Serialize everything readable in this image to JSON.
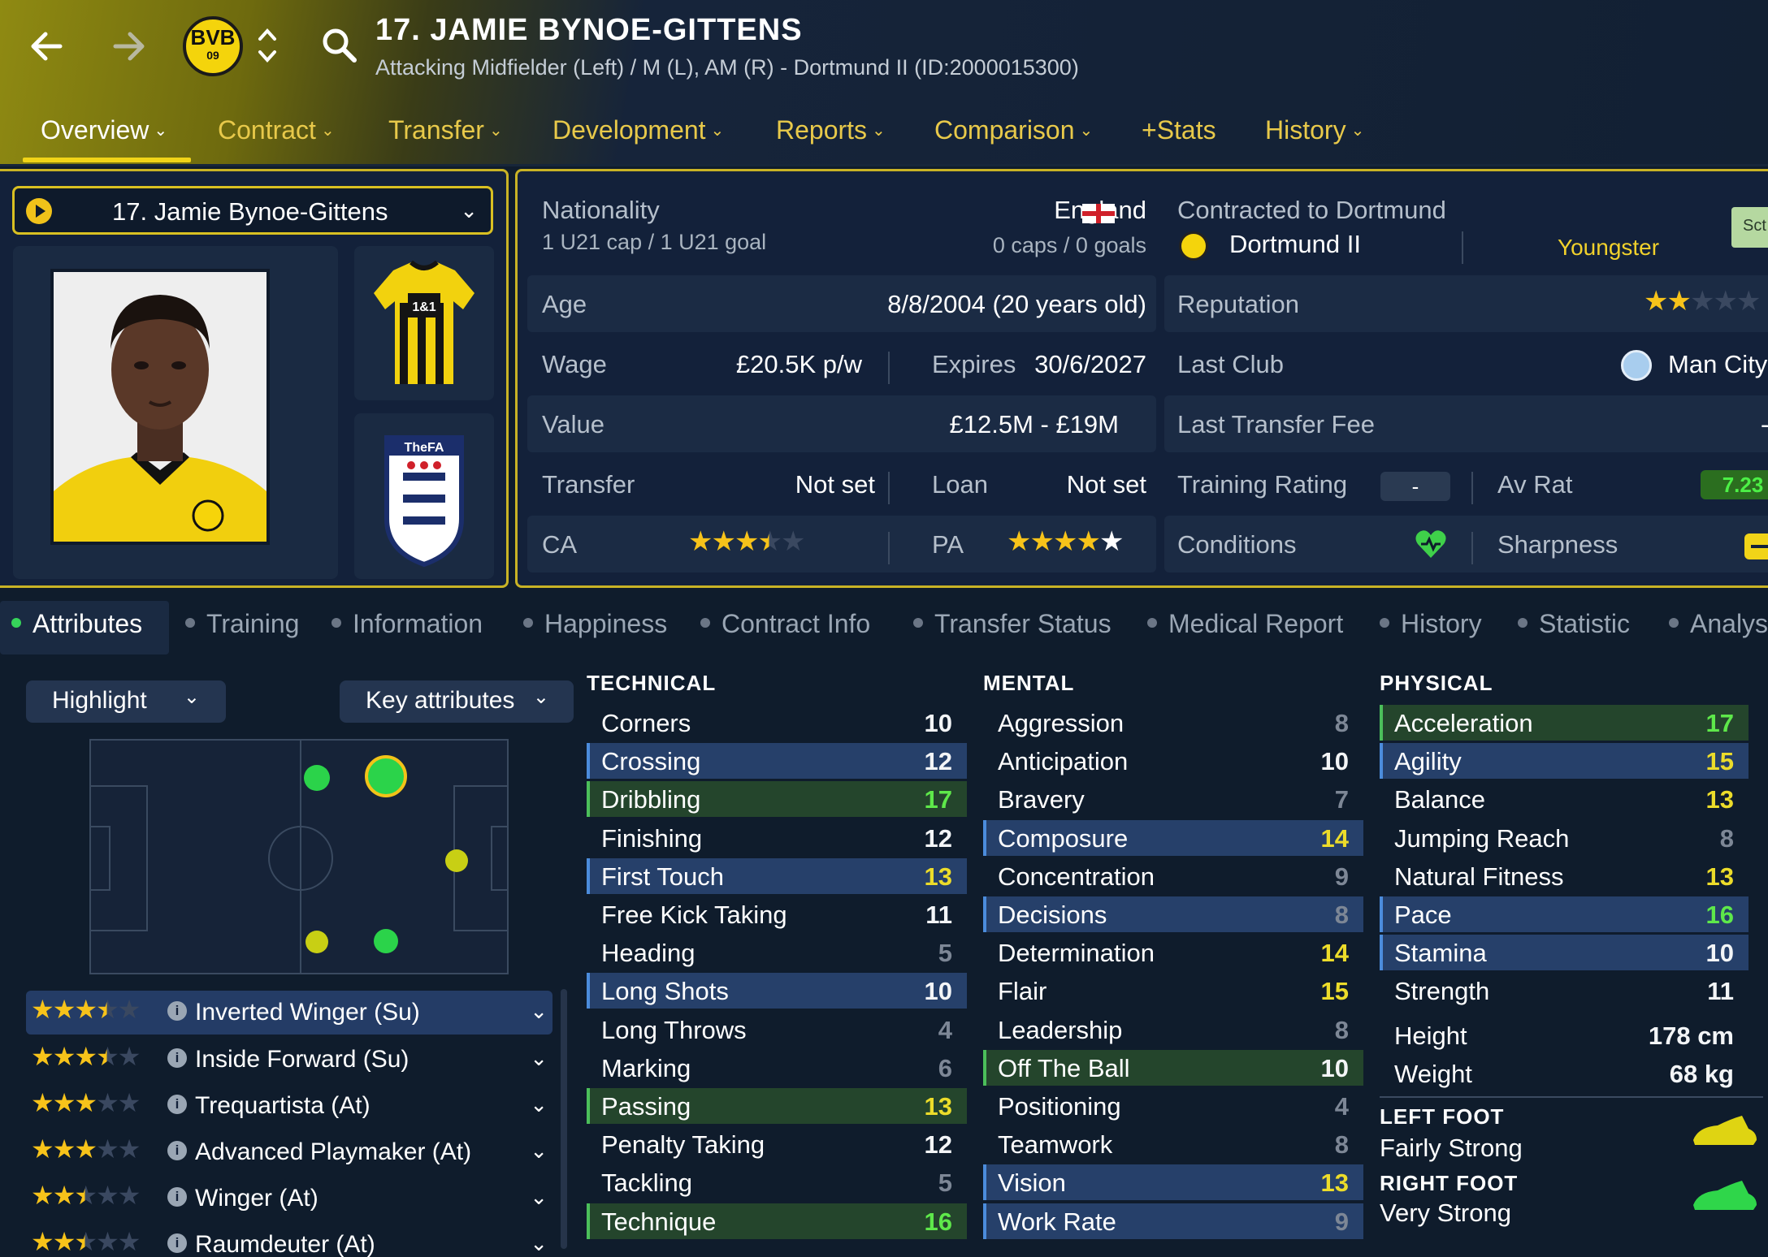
{
  "header": {
    "title": "17. JAMIE BYNOE-GITTENS",
    "subtitle": "Attacking Midfielder (Left) / M (L), AM (R) - Dortmund II (ID:2000015300)",
    "club_badge_text": "BVB",
    "club_badge_sub": "09"
  },
  "tabs": [
    {
      "label": "Overview",
      "chev": "⌄"
    },
    {
      "label": "Contract",
      "chev": "⌄"
    },
    {
      "label": "Transfer",
      "chev": "⌄"
    },
    {
      "label": "Development",
      "chev": "⌄"
    },
    {
      "label": "Reports",
      "chev": "⌄"
    },
    {
      "label": "Comparison",
      "chev": "⌄"
    },
    {
      "label": "+Stats",
      "chev": ""
    },
    {
      "label": "History",
      "chev": "⌄"
    }
  ],
  "player_select": {
    "name": "17. Jamie Bynoe-Gittens",
    "chev": "⌄"
  },
  "kit_sponsor": "1&1",
  "fa_badge": "TheFA",
  "info": {
    "nationality_label": "Nationality",
    "nationality": "England",
    "u21_caps": "1 U21 cap / 1 U21 goal",
    "caps": "0 caps / 0 goals",
    "contracted_label": "Contracted to Dortmund",
    "team": "Dortmund II",
    "youngster": "Youngster",
    "chip": "Sct",
    "age_label": "Age",
    "age": "8/8/2004 (20 years old)",
    "reputation_label": "Reputation",
    "reputation_stars": 2,
    "wage_label": "Wage",
    "wage": "£20.5K p/w",
    "expires_label": "Expires",
    "expires": "30/6/2027",
    "last_club_label": "Last Club",
    "last_club": "Man City",
    "value_label": "Value",
    "value": "£12.5M - £19M",
    "last_fee_label": "Last Transfer Fee",
    "last_fee": "-",
    "transfer_label": "Transfer",
    "transfer": "Not set",
    "loan_label": "Loan",
    "loan": "Not set",
    "training_label": "Training Rating",
    "training": "-",
    "avrat_label": "Av Rat",
    "avrat": "7.23",
    "ca_label": "CA",
    "ca_stars": 3.5,
    "pa_label": "PA",
    "pa_stars": 5,
    "conditions_label": "Conditions",
    "sharpness_label": "Sharpness"
  },
  "subtabs": [
    "Attributes",
    "Training",
    "Information",
    "Happiness",
    "Contract Info",
    "Transfer Status",
    "Medical Report",
    "History",
    "Statistic",
    "Analys"
  ],
  "controls": {
    "highlight": "Highlight",
    "key_attributes": "Key attributes",
    "chev": "⌄"
  },
  "roles": [
    {
      "name": "Inverted Winger (Su)",
      "stars": 3.5,
      "active": true
    },
    {
      "name": "Inside Forward (Su)",
      "stars": 3.5,
      "active": false
    },
    {
      "name": "Trequartista (At)",
      "stars": 3,
      "active": false
    },
    {
      "name": "Advanced Playmaker (At)",
      "stars": 3,
      "active": false
    },
    {
      "name": "Winger (At)",
      "stars": 2.5,
      "active": false
    },
    {
      "name": "Raumdeuter (At)",
      "stars": 2.5,
      "active": false
    }
  ],
  "technical_title": "TECHNICAL",
  "mental_title": "MENTAL",
  "physical_title": "PHYSICAL",
  "technical": [
    {
      "name": "Corners",
      "value": 10,
      "hl": ""
    },
    {
      "name": "Crossing",
      "value": 12,
      "hl": "blue"
    },
    {
      "name": "Dribbling",
      "value": 17,
      "hl": "green"
    },
    {
      "name": "Finishing",
      "value": 12,
      "hl": ""
    },
    {
      "name": "First Touch",
      "value": 13,
      "hl": "blue"
    },
    {
      "name": "Free Kick Taking",
      "value": 11,
      "hl": ""
    },
    {
      "name": "Heading",
      "value": 5,
      "hl": ""
    },
    {
      "name": "Long Shots",
      "value": 10,
      "hl": "blue"
    },
    {
      "name": "Long Throws",
      "value": 4,
      "hl": ""
    },
    {
      "name": "Marking",
      "value": 6,
      "hl": ""
    },
    {
      "name": "Passing",
      "value": 13,
      "hl": "green"
    },
    {
      "name": "Penalty Taking",
      "value": 12,
      "hl": ""
    },
    {
      "name": "Tackling",
      "value": 5,
      "hl": ""
    },
    {
      "name": "Technique",
      "value": 16,
      "hl": "green"
    }
  ],
  "mental": [
    {
      "name": "Aggression",
      "value": 8,
      "hl": ""
    },
    {
      "name": "Anticipation",
      "value": 10,
      "hl": ""
    },
    {
      "name": "Bravery",
      "value": 7,
      "hl": ""
    },
    {
      "name": "Composure",
      "value": 14,
      "hl": "blue"
    },
    {
      "name": "Concentration",
      "value": 9,
      "hl": ""
    },
    {
      "name": "Decisions",
      "value": 8,
      "hl": "blue"
    },
    {
      "name": "Determination",
      "value": 14,
      "hl": ""
    },
    {
      "name": "Flair",
      "value": 15,
      "hl": ""
    },
    {
      "name": "Leadership",
      "value": 8,
      "hl": ""
    },
    {
      "name": "Off The Ball",
      "value": 10,
      "hl": "green"
    },
    {
      "name": "Positioning",
      "value": 4,
      "hl": ""
    },
    {
      "name": "Teamwork",
      "value": 8,
      "hl": ""
    },
    {
      "name": "Vision",
      "value": 13,
      "hl": "blue"
    },
    {
      "name": "Work Rate",
      "value": 9,
      "hl": "blue"
    }
  ],
  "physical": [
    {
      "name": "Acceleration",
      "value": 17,
      "hl": "green"
    },
    {
      "name": "Agility",
      "value": 15,
      "hl": "blue"
    },
    {
      "name": "Balance",
      "value": 13,
      "hl": ""
    },
    {
      "name": "Jumping Reach",
      "value": 8,
      "hl": ""
    },
    {
      "name": "Natural Fitness",
      "value": 13,
      "hl": ""
    },
    {
      "name": "Pace",
      "value": 16,
      "hl": "blue"
    },
    {
      "name": "Stamina",
      "value": 10,
      "hl": "blue"
    },
    {
      "name": "Strength",
      "value": 11,
      "hl": ""
    }
  ],
  "physical_extra": {
    "height_label": "Height",
    "height": "178 cm",
    "weight_label": "Weight",
    "weight": "68 kg",
    "left_foot_label": "LEFT FOOT",
    "left_foot": "Fairly Strong",
    "right_foot_label": "RIGHT FOOT",
    "right_foot": "Very Strong"
  },
  "colors": {
    "accent": "#f1d418",
    "brand_yellow": "#f4d40c",
    "highlight_blue": "#26406a",
    "highlight_green": "#24452c"
  }
}
